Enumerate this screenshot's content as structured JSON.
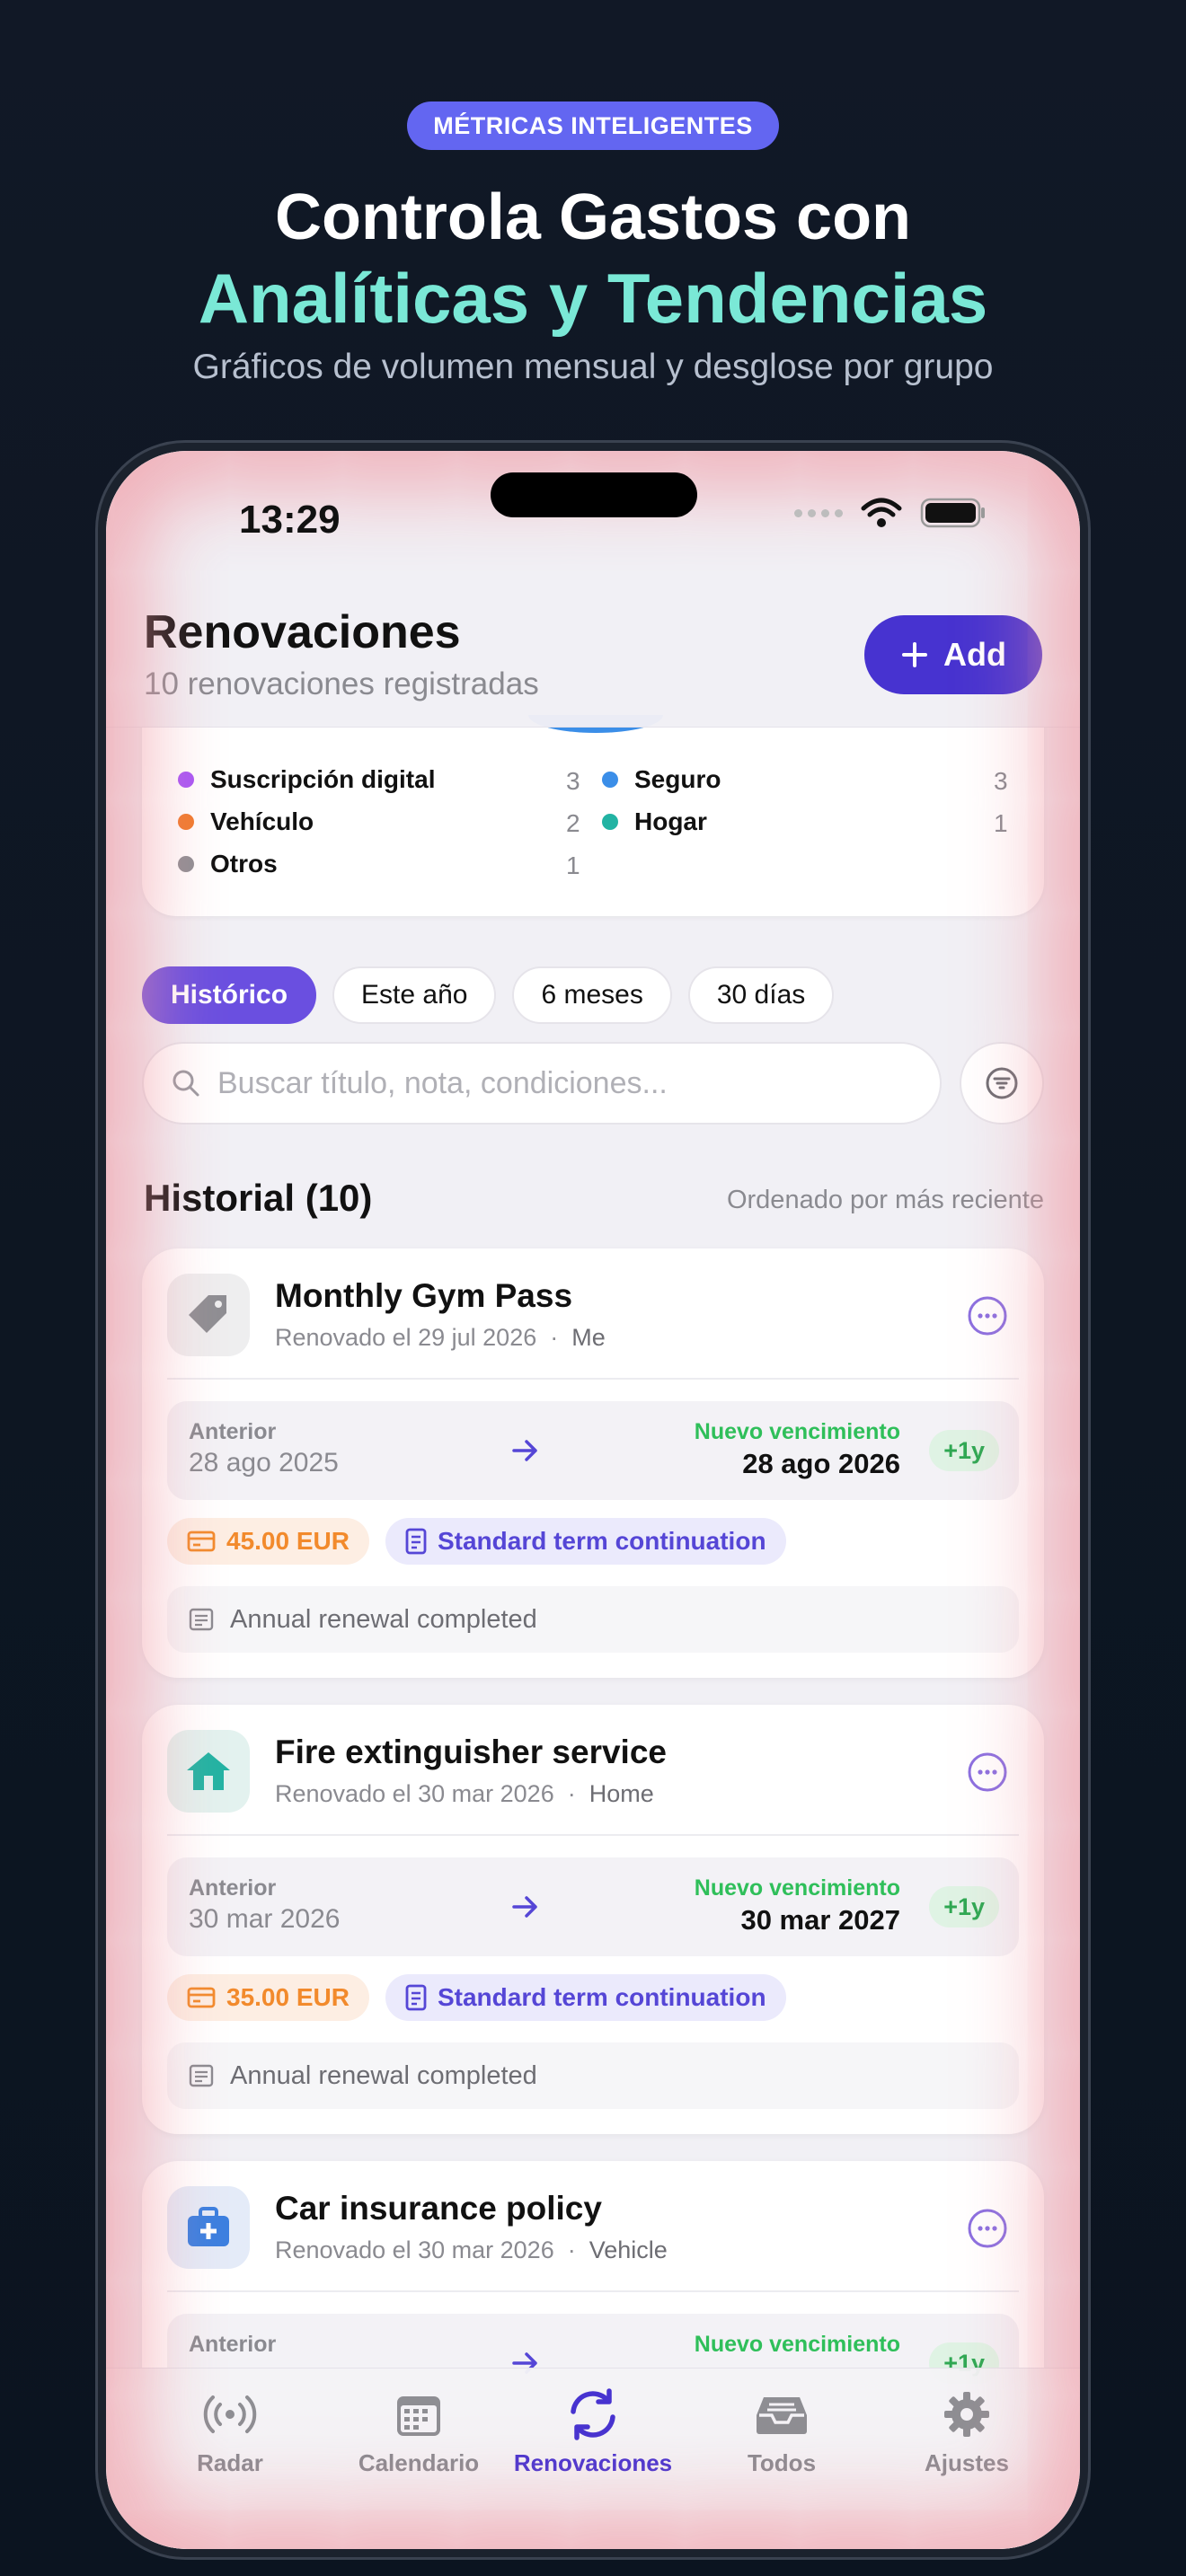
{
  "promo": {
    "badge": "MÉTRICAS INTELIGENTES",
    "title_line1": "Controla Gastos con",
    "title_line2": "Analíticas y Tendencias",
    "subtitle": "Gráficos de volumen mensual y desglose por grupo"
  },
  "status_bar": {
    "time": "13:29"
  },
  "header": {
    "title": "Renovaciones",
    "subtitle": "10 renovaciones registradas",
    "add_label": "Add"
  },
  "legend": {
    "items": [
      {
        "label": "Suscripción digital",
        "count": "3",
        "color": "#a855f7"
      },
      {
        "label": "Seguro",
        "count": "3",
        "color": "#3b8ee8"
      },
      {
        "label": "Vehículo",
        "count": "2",
        "color": "#f07a2c"
      },
      {
        "label": "Hogar",
        "count": "1",
        "color": "#22b3a3"
      },
      {
        "label": "Otros",
        "count": "1",
        "color": "#8e8e93"
      }
    ]
  },
  "filters": {
    "chips": [
      "Histórico",
      "Este año",
      "6 meses",
      "30 días"
    ],
    "active": "Histórico"
  },
  "search": {
    "placeholder": "Buscar título, nota, condiciones..."
  },
  "history": {
    "title": "Historial (10)",
    "sort": "Ordenado por más reciente",
    "cards": [
      {
        "title": "Monthly Gym Pass",
        "renewed": "Renovado el 29 jul 2026",
        "group": "Me",
        "prev_label": "Anterior",
        "prev_date": "28 ago 2025",
        "new_label": "Nuevo vencimiento",
        "new_date": "28 ago 2026",
        "delta": "+1y",
        "price": "45.00 EUR",
        "term": "Standard term continuation",
        "note": "Annual renewal completed",
        "icon": "tag-icon"
      },
      {
        "title": "Fire extinguisher service",
        "renewed": "Renovado el 30 mar 2026",
        "group": "Home",
        "prev_label": "Anterior",
        "prev_date": "30 mar 2026",
        "new_label": "Nuevo vencimiento",
        "new_date": "30 mar 2027",
        "delta": "+1y",
        "price": "35.00 EUR",
        "term": "Standard term continuation",
        "note": "Annual renewal completed",
        "icon": "house-icon"
      },
      {
        "title": "Car insurance policy",
        "renewed": "Renovado el 30 mar 2026",
        "group": "Vehicle",
        "prev_label": "Anterior",
        "new_label": "Nuevo vencimiento",
        "delta": "+1y",
        "icon": "medkit-icon"
      }
    ]
  },
  "tabbar": {
    "tabs": [
      "Radar",
      "Calendario",
      "Renovaciones",
      "Todos",
      "Ajustes"
    ],
    "active": "Renovaciones"
  },
  "colors": {
    "accent": "#4733d0",
    "promo_teal": "#7ae8d6",
    "badge": "#6366f1"
  }
}
